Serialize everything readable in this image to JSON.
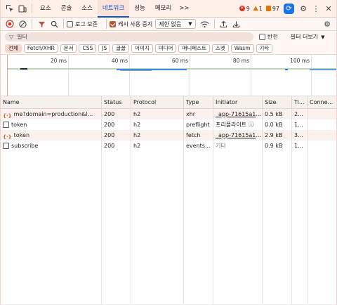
{
  "tabs": [
    "요소",
    "콘솔",
    "소스",
    "네트워크",
    "성능",
    "메모리"
  ],
  "active_tab": "네트워크",
  "more_tabs": ">>",
  "badges": {
    "errors": "9",
    "warnings": "1",
    "info": "97"
  },
  "toolbar": {
    "preserve_log": "로그 보존",
    "disable_cache": "캐시 사용 중지",
    "throttle": "제한 없음"
  },
  "filter": {
    "placeholder": "필터",
    "invert": "반전",
    "more_filters": "필터 더보기"
  },
  "type_chips": [
    "전체",
    "Fetch/XHR",
    "문서",
    "CSS",
    "JS",
    "글꼴",
    "이미지",
    "미디어",
    "매니페스트",
    "소켓",
    "Wasm",
    "기타"
  ],
  "active_chip": "전체",
  "timeline": {
    "ticks": [
      "20 ms",
      "40 ms",
      "60 ms",
      "80 ms",
      "100 ms"
    ]
  },
  "columns": [
    "Name",
    "Status",
    "Protocol",
    "Type",
    "Initiator",
    "Size",
    "Ti...",
    "Conne..."
  ],
  "rows": [
    {
      "icon": "xhr-icon",
      "name": "me?domain=production&l...",
      "status": "200",
      "protocol": "h2",
      "type": "xhr",
      "initiator": "_app-71615a1d3...",
      "size": "0.5 kB",
      "time": "2..."
    },
    {
      "icon": "document-icon",
      "name": "token",
      "status": "200",
      "protocol": "h2",
      "type": "preflight",
      "initiator": "프리플라이트 ⓘ",
      "size": "0.0 kB",
      "time": "1..."
    },
    {
      "icon": "xhr-icon",
      "name": "token",
      "status": "200",
      "protocol": "h2",
      "type": "fetch",
      "initiator": "_app-71615a1d3...",
      "size": "2.9 kB",
      "time": "3..."
    },
    {
      "icon": "document-icon",
      "name": "subscribe",
      "status": "200",
      "protocol": "h2",
      "type": "events...",
      "initiator": "기타",
      "size": "0.9 kB",
      "time": "1..."
    }
  ],
  "colors": {
    "accent": "#0b57d0",
    "error": "#d93025",
    "warning": "#e37400",
    "chip_active": "#f5d7cd"
  }
}
